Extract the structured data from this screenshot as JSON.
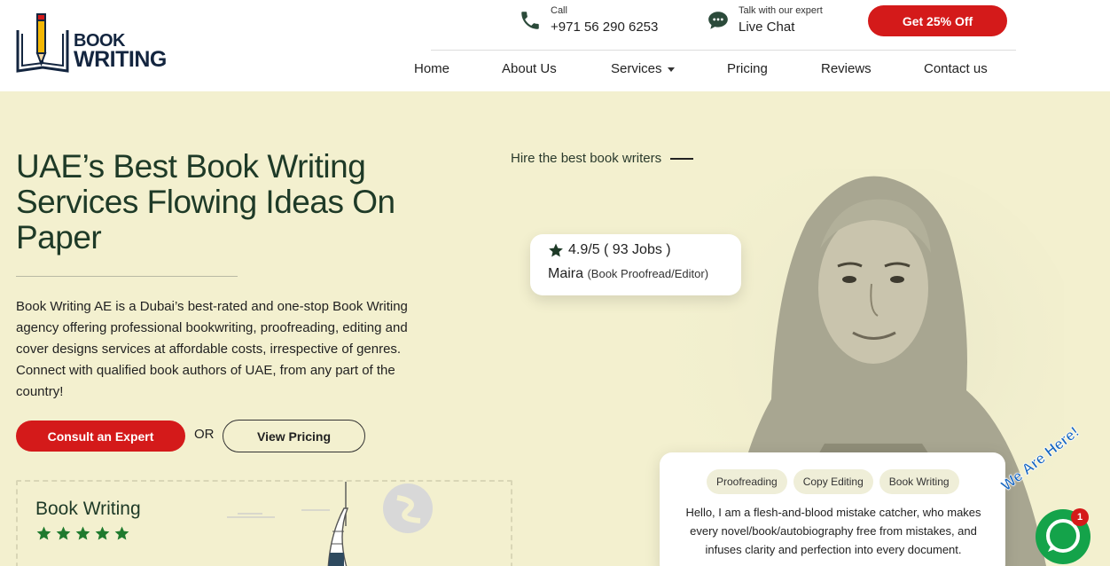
{
  "header": {
    "logo": {
      "line1": "BOOK",
      "line2": "WRITING"
    },
    "call": {
      "label": "Call",
      "value": "+971 56 290 6253",
      "icon": "phone-icon"
    },
    "chat": {
      "label": "Talk with our expert",
      "value": "Live Chat",
      "icon": "chat-icon"
    },
    "cta": "Get 25% Off",
    "nav": [
      "Home",
      "About Us",
      "Services",
      "Pricing",
      "Reviews",
      "Contact us"
    ]
  },
  "hero": {
    "title": "UAE’s Best Book Writing Services Flowing Ideas On Paper",
    "description": "Book Writing AE is a Dubai’s best-rated and one-stop Book Writing agency offering professional bookwriting, proofreading, editing and cover designs services at affordable costs, irrespective of genres. Connect with qualified book authors of UAE, from any part of the country!",
    "consult_button": "Consult an Expert",
    "or": "OR",
    "pricing_button": "View Pricing",
    "card_title": "Book Writing",
    "stars": 5
  },
  "writer": {
    "hire_label": "Hire the best book writers",
    "rating": "4.9/5 ( 93 Jobs )",
    "name": "Maira",
    "role": "(Book Proofread/Editor)",
    "tags": [
      "Proofreading",
      "Copy Editing",
      "Book Writing"
    ],
    "bio": "Hello, I am a flesh-and-blood mistake catcher, who makes every novel/book/autobiography free from mistakes, and infuses clarity and perfection into every document."
  },
  "chat_widget": {
    "label": "We Are Here!",
    "badge": "1"
  },
  "colors": {
    "accent": "#d41a1a",
    "background": "#f3f0cf",
    "heading": "#1e3a27",
    "star": "#1f7a2e",
    "chat": "#14a34a"
  }
}
